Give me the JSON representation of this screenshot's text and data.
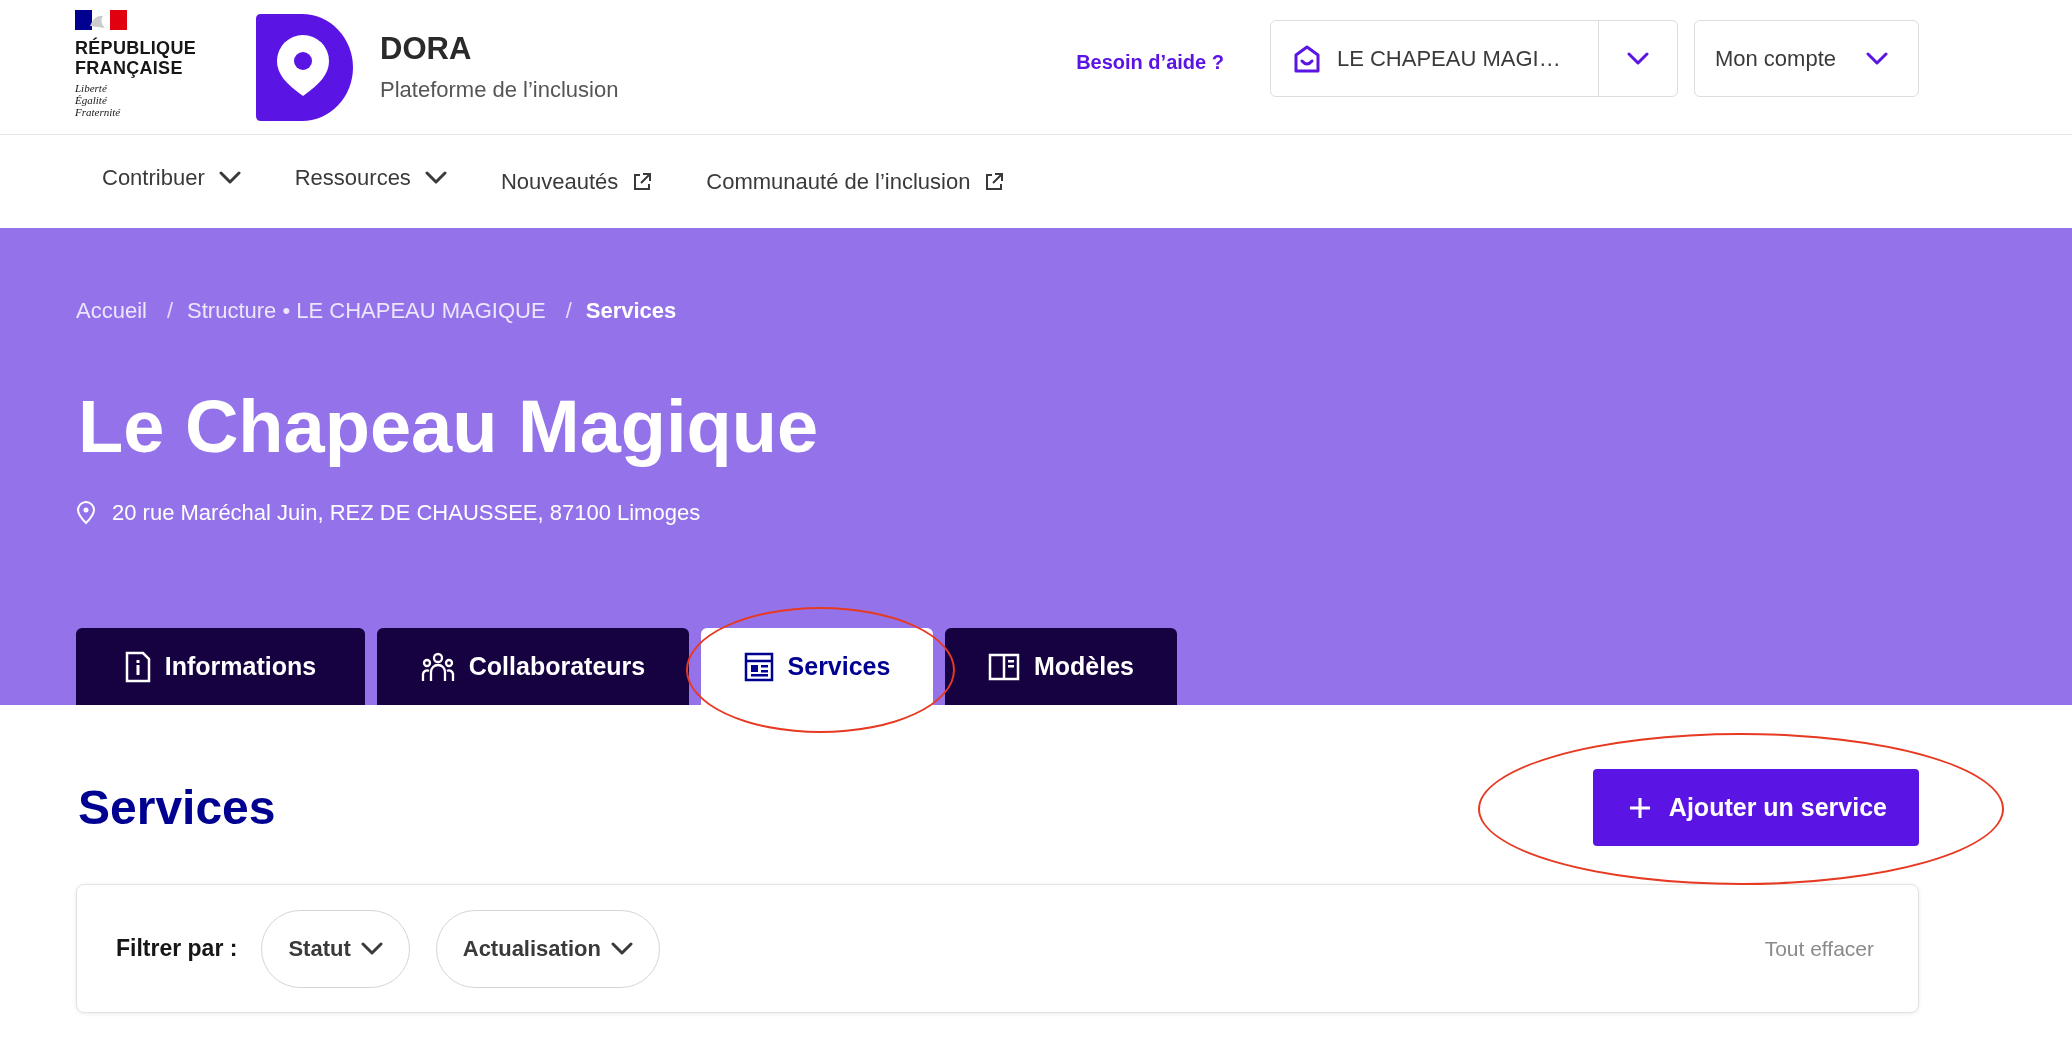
{
  "header": {
    "gov_logo": {
      "lines": [
        "RÉPUBLIQUE",
        "FRANÇAISE"
      ],
      "motto": [
        "Liberté",
        "Égalité",
        "Fraternité"
      ]
    },
    "brand": {
      "name": "DORA",
      "tagline": "Plateforme de l’inclusion"
    },
    "help_link": "Besoin d’aide ?",
    "structure_select": {
      "value": "LE CHAPEAU MAGI…"
    },
    "account_menu": {
      "label": "Mon compte"
    }
  },
  "nav": [
    {
      "label": "Contribuer",
      "kind": "dropdown"
    },
    {
      "label": "Ressources",
      "kind": "dropdown"
    },
    {
      "label": "Nouveautés",
      "kind": "external"
    },
    {
      "label": "Communauté de l’inclusion",
      "kind": "external"
    }
  ],
  "breadcrumb": [
    {
      "label": "Accueil",
      "current": false
    },
    {
      "separator": "/",
      "label": "Structure • LE CHAPEAU MAGIQUE",
      "current": false
    },
    {
      "separator": "/",
      "label": "Services",
      "current": true
    }
  ],
  "structure": {
    "title": "Le Chapeau Magique",
    "address": "20 rue Maréchal Juin, REZ DE CHAUSSEE, 87100 Limoges"
  },
  "tabs": [
    {
      "label": "Informations",
      "selected": false
    },
    {
      "label": "Collaborateurs",
      "selected": false
    },
    {
      "label": "Services",
      "selected": true
    },
    {
      "label": "Modèles",
      "selected": false
    }
  ],
  "services": {
    "heading": "Services",
    "add_button": "Ajouter un service",
    "filter": {
      "label": "Filtrer par :",
      "filters": [
        "Statut",
        "Actualisation"
      ],
      "clear": "Tout effacer"
    }
  }
}
